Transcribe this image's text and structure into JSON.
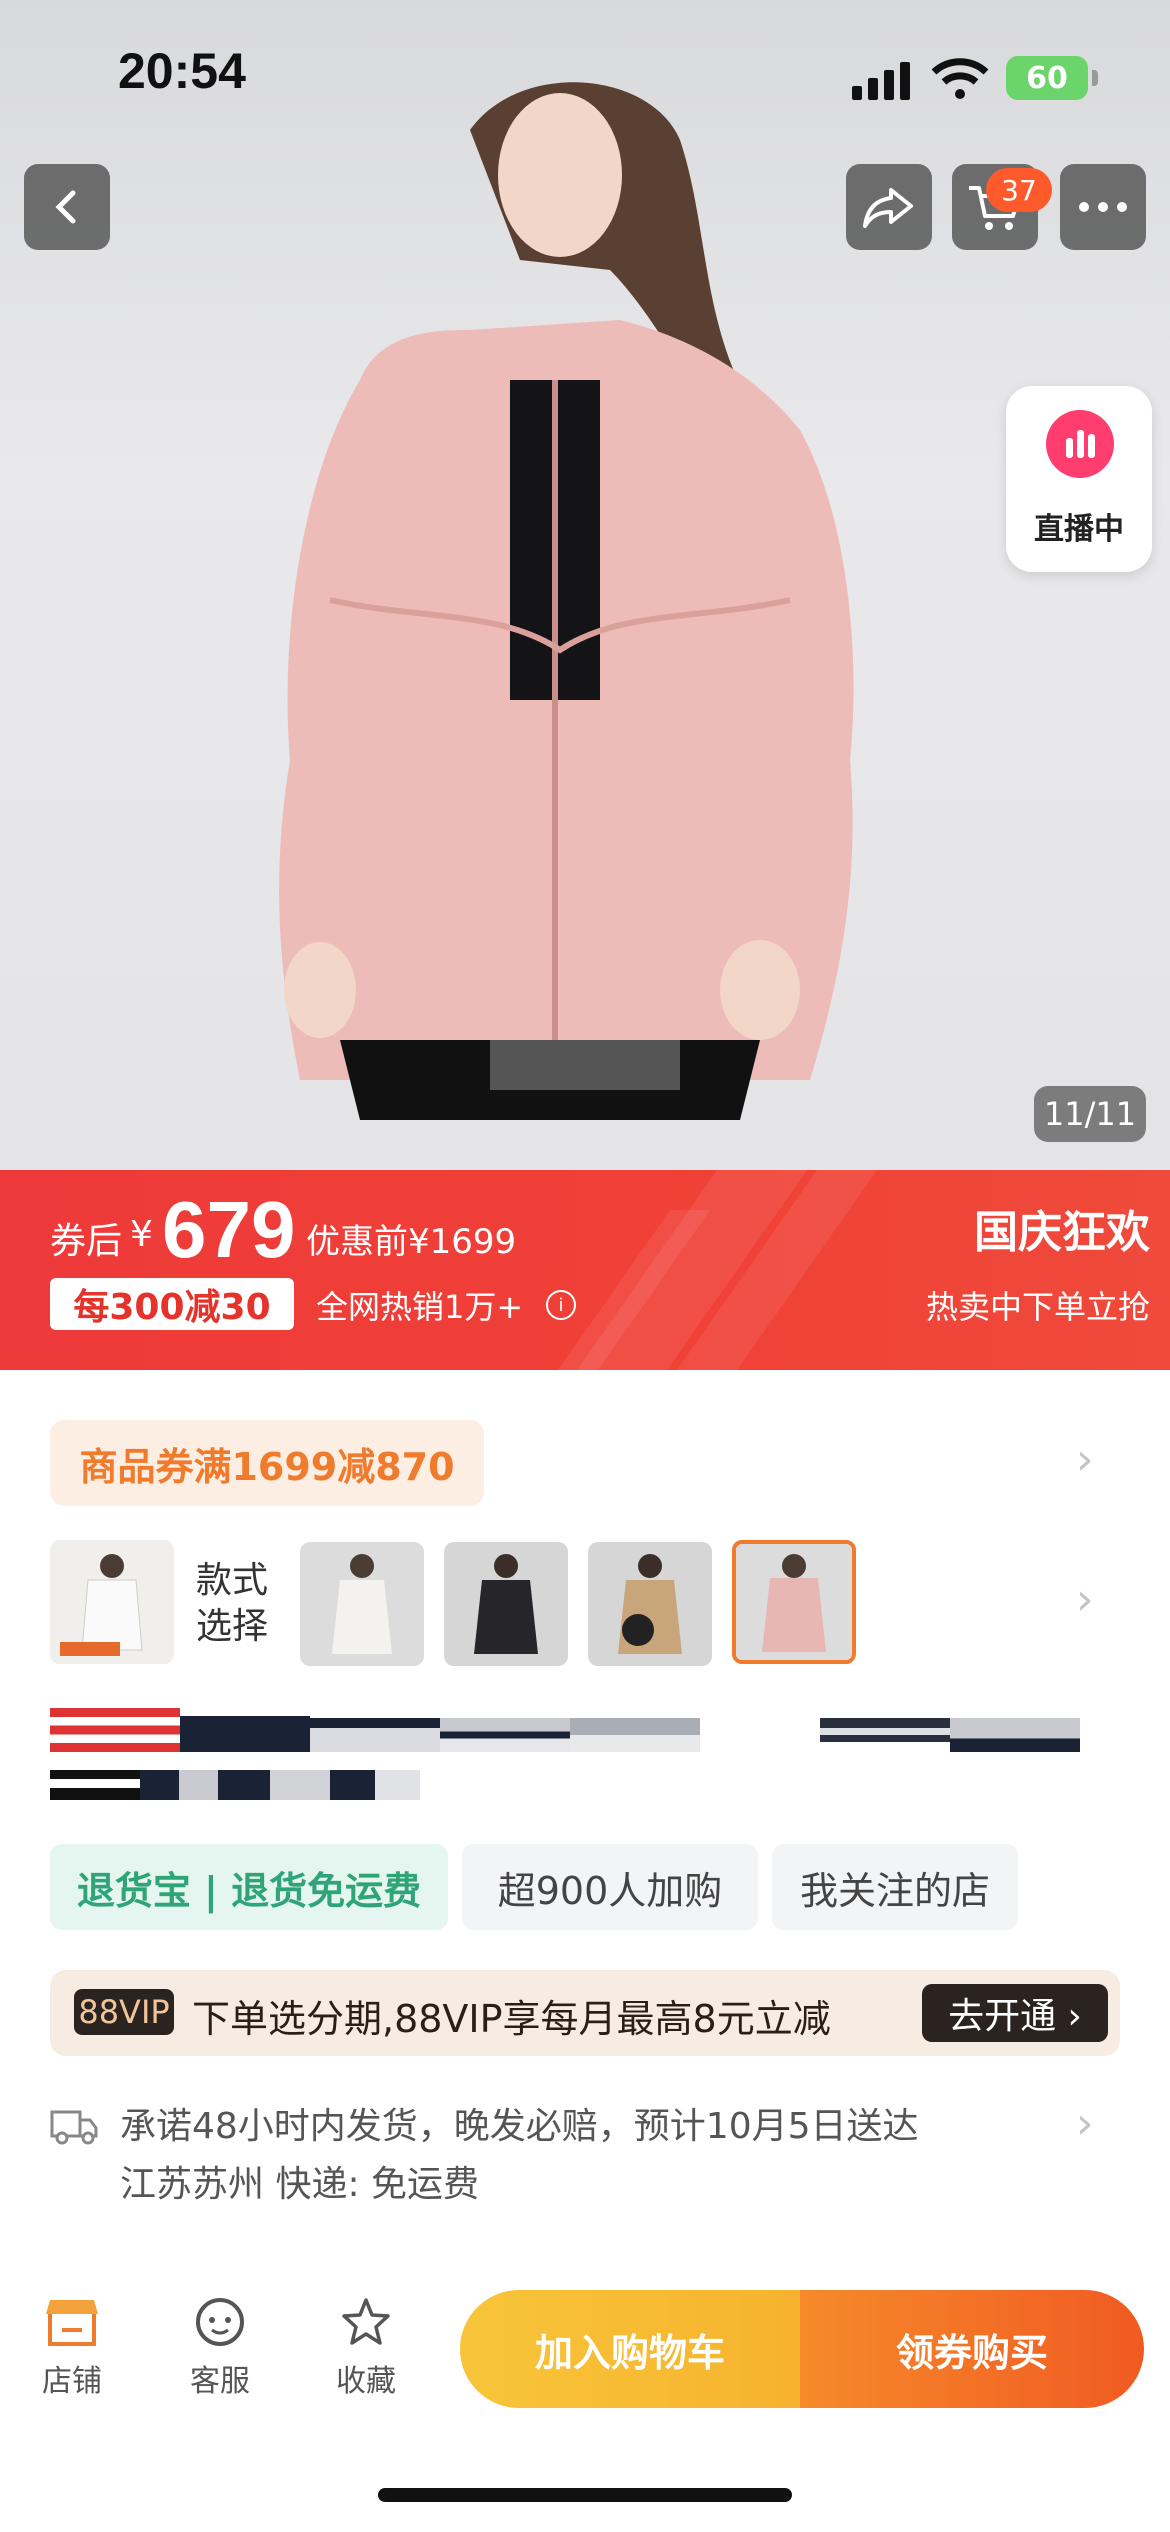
{
  "status_bar": {
    "time": "20:54",
    "battery": "60"
  },
  "header": {
    "cart_count": "37"
  },
  "live": {
    "label": "直播中"
  },
  "gallery": {
    "counter": "11/11"
  },
  "price": {
    "prefix": "券后",
    "currency": "¥",
    "amount": "679",
    "original": "优惠前¥1699",
    "discount_tag": "每300减30",
    "sales": "全网热销1万+"
  },
  "promo": {
    "title": "国庆狂欢",
    "subtitle": "热卖中下单立抢"
  },
  "coupon": {
    "label": "商品券满1699减870"
  },
  "variants": {
    "label": "款式选择",
    "colors": [
      "#e8e6e2",
      "#2a2a2e",
      "#c8a57a",
      "#e8b7b4"
    ]
  },
  "tags": {
    "return": "退货宝 | 退货免运费",
    "cart_users": "超900人加购",
    "followed": "我关注的店"
  },
  "vip": {
    "badge": "88VIP",
    "text": "下单选分期,88VIP享每月最高8元立减",
    "button": "去开通 ›"
  },
  "shipping": {
    "line1": "承诺48小时内发货，晚发必赔，预计10月5日送达",
    "line2": "江苏苏州  快递: 免运费"
  },
  "bottom_nav": {
    "store": "店铺",
    "service": "客服",
    "favorite": "收藏"
  },
  "actions": {
    "add_cart": "加入购物车",
    "buy": "领券购买"
  },
  "colors": {
    "accent_red": "#ee3a3a",
    "accent_orange": "#f05a22",
    "accent_yellow": "#f8c53a"
  }
}
